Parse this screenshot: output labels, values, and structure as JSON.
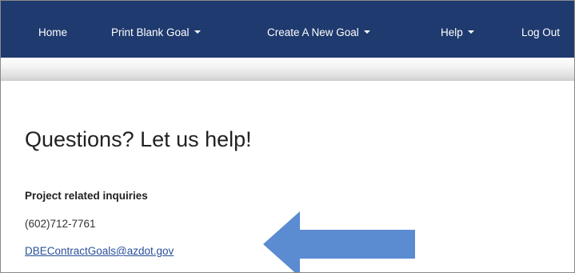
{
  "nav": {
    "items": [
      {
        "label": "Home",
        "dropdown": false
      },
      {
        "label": "Print Blank Goal",
        "dropdown": true
      },
      {
        "label": "Create A New Goal",
        "dropdown": true
      },
      {
        "label": "Help",
        "dropdown": true
      },
      {
        "label": "Log Out",
        "dropdown": false
      }
    ]
  },
  "content": {
    "title": "Questions? Let us help!",
    "section_title": "Project related inquiries",
    "phone": "(602)712-7761",
    "email": "DBEContractGoals@azdot.gov"
  },
  "icons": {
    "dropdown": "caret-down-icon",
    "pointer": "arrow-left-icon"
  },
  "colors": {
    "navbar": "#1f3a6e",
    "link": "#2a4f9a",
    "arrow": "#5b8bd1"
  }
}
